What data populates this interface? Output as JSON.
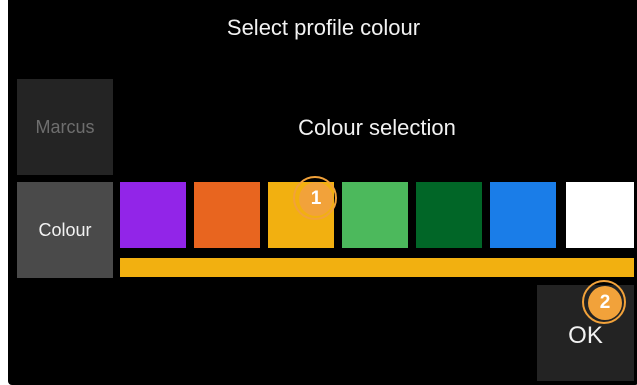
{
  "header": {
    "title": "Select profile colour"
  },
  "sidebar": {
    "profile_name": "Marcus",
    "colour_label": "Colour"
  },
  "main": {
    "selection_title": "Colour selection",
    "swatches": [
      {
        "name": "purple",
        "color": "#9225e8"
      },
      {
        "name": "orange",
        "color": "#e8651f"
      },
      {
        "name": "amber",
        "color": "#f2b010"
      },
      {
        "name": "light-green",
        "color": "#4cb95c"
      },
      {
        "name": "dark-green",
        "color": "#016627"
      },
      {
        "name": "blue",
        "color": "#1a7de8"
      },
      {
        "name": "white",
        "color": "#ffffff"
      }
    ],
    "selected_index": 2,
    "selected_color": "#f2b010"
  },
  "footer": {
    "ok_label": "OK"
  },
  "markers": [
    {
      "label": "1",
      "color": "#f2a23a"
    },
    {
      "label": "2",
      "color": "#f2a23a"
    }
  ]
}
